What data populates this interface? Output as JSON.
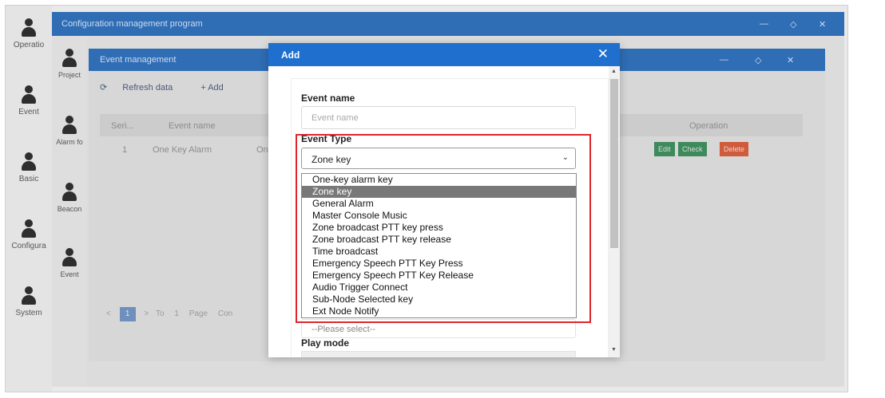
{
  "left_rail": [
    "Operatio",
    "Event",
    "Basic",
    "Configura",
    "System"
  ],
  "config_window": {
    "title": "Configuration management program",
    "min": "—",
    "max": "◇",
    "close": "✕"
  },
  "second_rail": [
    "Project",
    "Alarm fo",
    "Beacon",
    "Event"
  ],
  "event_window": {
    "title": "Event management",
    "toolbar": {
      "refresh_icon": "refresh-icon",
      "refresh_label": "Refresh data",
      "add_label": "+ Add"
    },
    "columns": {
      "serial": "Seri...",
      "event_name": "Event name",
      "operation": "Operation"
    },
    "row": {
      "serial": "1",
      "event_name": "One Key Alarm",
      "type_partial": "One",
      "edit": "Edit",
      "check": "Check",
      "delete": "Delete"
    },
    "pager": {
      "prev": "<",
      "page": "1",
      "next": ">",
      "to": "To",
      "page_input": "1",
      "page_label": "Page",
      "confirm_partial": "Con"
    }
  },
  "modal": {
    "title": "Add",
    "close": "✕",
    "event_name_label": "Event name",
    "event_name_placeholder": "Event name",
    "event_type_label": "Event Type",
    "event_type_value": "Zone key",
    "options": [
      "One-key alarm key",
      "Zone key",
      "General Alarm",
      "Master Console Music",
      "Zone broadcast PTT key press",
      "Zone broadcast PTT key release",
      "Time broadcast",
      "Emergency Speech PTT Key Press",
      "Emergency Speech PTT Key Release",
      "Audio Trigger Connect",
      "Sub-Node Selected key",
      "Ext Node Notify"
    ],
    "selected_option_index": 1,
    "partial_select_text": "--Please select--",
    "play_mode_label": "Play mode"
  },
  "colors": {
    "title_bar": "#1f6fcf",
    "highlight_box": "#e0242a",
    "edit": "#3d8a5a",
    "check": "#3d8a5a",
    "delete": "#d05a3a"
  }
}
